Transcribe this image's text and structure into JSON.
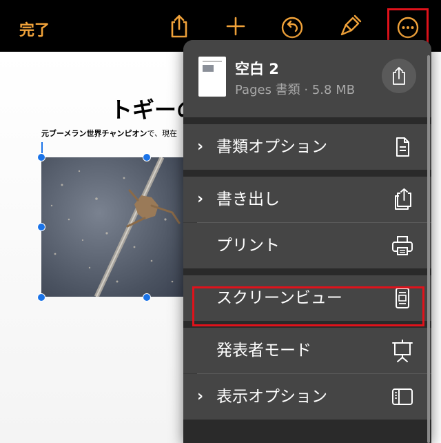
{
  "toolbar": {
    "done_label": "完了"
  },
  "document": {
    "title": "トギーの",
    "line_bold": "元ブーメラン世界チャンピオン",
    "line_rest": "で、現在"
  },
  "menu": {
    "file_name": "空白 2",
    "file_info": "Pages 書類 · 5.8 MB",
    "items": [
      {
        "label": "書類オプション",
        "chevron": "›"
      },
      {
        "label": "書き出し",
        "chevron": "›"
      },
      {
        "label": "プリント",
        "chevron": ""
      },
      {
        "label": "スクリーンビュー",
        "chevron": ""
      },
      {
        "label": "発表者モード",
        "chevron": ""
      },
      {
        "label": "表示オプション",
        "chevron": "›"
      }
    ]
  },
  "colors": {
    "accent": "#f2a33a",
    "highlight": "#e0121b",
    "menu_bg": "#454545",
    "selection": "#1a73e8"
  },
  "icons": [
    "share-icon",
    "add-icon",
    "undo-icon",
    "paintbrush-icon",
    "more-icon",
    "document-icon",
    "export-icon",
    "printer-icon",
    "screen-view-icon",
    "presenter-icon",
    "sidebar-icon"
  ]
}
